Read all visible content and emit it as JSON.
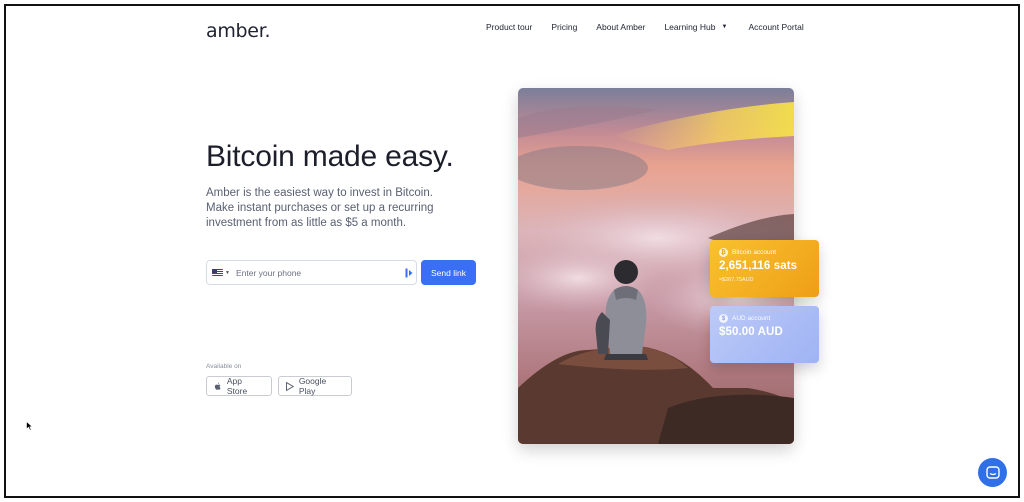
{
  "brand": {
    "logo": "amber."
  },
  "nav": {
    "items": [
      {
        "label": "Product tour"
      },
      {
        "label": "Pricing"
      },
      {
        "label": "About Amber"
      },
      {
        "label": "Learning Hub"
      },
      {
        "label": "Account Portal"
      }
    ]
  },
  "hero": {
    "title": "Bitcoin made easy.",
    "subtitle": "Amber is the easiest way to invest in Bitcoin. Make instant purchases or set up a recurring investment from as little as $5 a month."
  },
  "signup": {
    "phone_placeholder": "Enter your phone",
    "phone_value": "",
    "send_label": "Send link"
  },
  "stores": {
    "available_label": "Available on",
    "app_store": "App Store",
    "google_play": "Google Play"
  },
  "cards": {
    "bitcoin": {
      "title": "Bitcoin account",
      "amount": "2,651,116 sats",
      "fiat": "≈$267.75AUD",
      "symbol": "₿"
    },
    "aud": {
      "title": "AUD account",
      "amount": "$50.00 AUD",
      "symbol": "$"
    }
  },
  "colors": {
    "accent": "#3a6ef5",
    "bitcoin_card": "#f5b325",
    "aud_card": "#aebff5",
    "chat": "#2f6fe8"
  }
}
